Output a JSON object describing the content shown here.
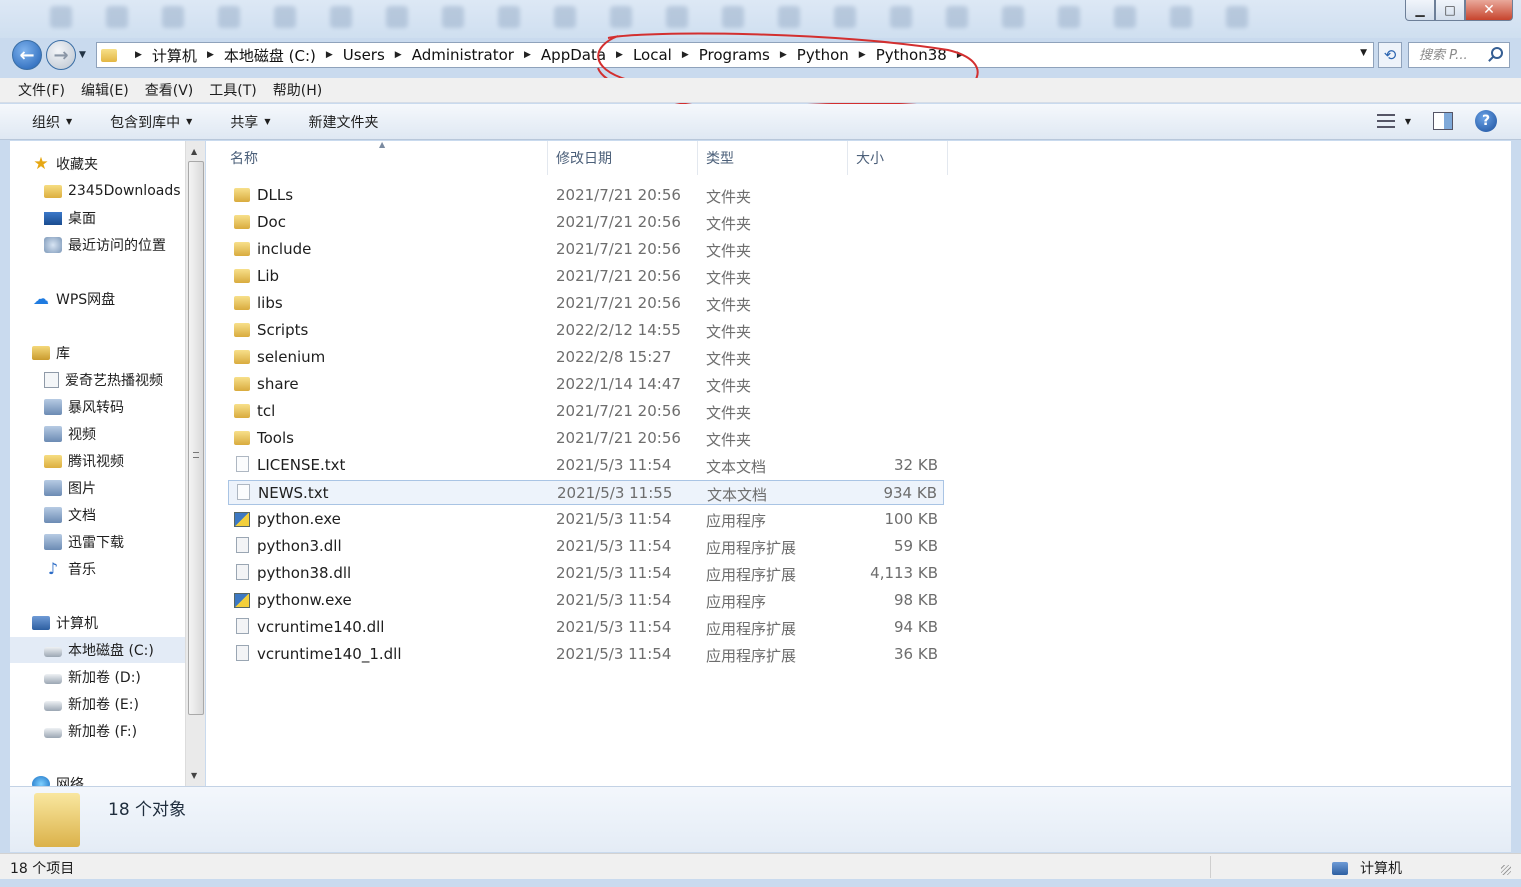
{
  "window": {
    "buttons": {
      "minimize": "▁",
      "maximize": "□",
      "close": "✕"
    }
  },
  "address": {
    "crumbs": [
      "计算机",
      "本地磁盘 (C:)",
      "Users",
      "Administrator",
      "AppData",
      "Local",
      "Programs",
      "Python",
      "Python38"
    ],
    "annotation_color": "#d32f2f"
  },
  "search": {
    "placeholder": "搜索 P..."
  },
  "menu": [
    "文件(F)",
    "编辑(E)",
    "查看(V)",
    "工具(T)",
    "帮助(H)"
  ],
  "toolbar": {
    "organize": "组织",
    "include_library": "包含到库中",
    "share": "共享",
    "new_folder": "新建文件夹"
  },
  "sidebar": {
    "favorites": {
      "label": "收藏夹",
      "items": [
        "2345Downloads",
        "桌面",
        "最近访问的位置"
      ]
    },
    "wps": "WPS网盘",
    "libraries": {
      "label": "库",
      "items": [
        "爱奇艺热播视频",
        "暴风转码",
        "视频",
        "腾讯视频",
        "图片",
        "文档",
        "迅雷下载",
        "音乐"
      ]
    },
    "computer": {
      "label": "计算机",
      "items": [
        "本地磁盘 (C:)",
        "新加卷 (D:)",
        "新加卷 (E:)",
        "新加卷 (F:)"
      ]
    },
    "network": "网络"
  },
  "columns": {
    "name": "名称",
    "date": "修改日期",
    "type": "类型",
    "size": "大小"
  },
  "files": [
    {
      "name": "DLLs",
      "date": "2021/7/21 20:56",
      "type": "文件夹",
      "size": "",
      "kind": "folder"
    },
    {
      "name": "Doc",
      "date": "2021/7/21 20:56",
      "type": "文件夹",
      "size": "",
      "kind": "folder"
    },
    {
      "name": "include",
      "date": "2021/7/21 20:56",
      "type": "文件夹",
      "size": "",
      "kind": "folder"
    },
    {
      "name": "Lib",
      "date": "2021/7/21 20:56",
      "type": "文件夹",
      "size": "",
      "kind": "folder"
    },
    {
      "name": "libs",
      "date": "2021/7/21 20:56",
      "type": "文件夹",
      "size": "",
      "kind": "folder"
    },
    {
      "name": "Scripts",
      "date": "2022/2/12 14:55",
      "type": "文件夹",
      "size": "",
      "kind": "folder"
    },
    {
      "name": "selenium",
      "date": "2022/2/8 15:27",
      "type": "文件夹",
      "size": "",
      "kind": "folder"
    },
    {
      "name": "share",
      "date": "2022/1/14 14:47",
      "type": "文件夹",
      "size": "",
      "kind": "folder"
    },
    {
      "name": "tcl",
      "date": "2021/7/21 20:56",
      "type": "文件夹",
      "size": "",
      "kind": "folder"
    },
    {
      "name": "Tools",
      "date": "2021/7/21 20:56",
      "type": "文件夹",
      "size": "",
      "kind": "folder"
    },
    {
      "name": "LICENSE.txt",
      "date": "2021/5/3 11:54",
      "type": "文本文档",
      "size": "32 KB",
      "kind": "txt"
    },
    {
      "name": "NEWS.txt",
      "date": "2021/5/3 11:55",
      "type": "文本文档",
      "size": "934 KB",
      "kind": "txt"
    },
    {
      "name": "python.exe",
      "date": "2021/5/3 11:54",
      "type": "应用程序",
      "size": "100 KB",
      "kind": "exe"
    },
    {
      "name": "python3.dll",
      "date": "2021/5/3 11:54",
      "type": "应用程序扩展",
      "size": "59 KB",
      "kind": "dll"
    },
    {
      "name": "python38.dll",
      "date": "2021/5/3 11:54",
      "type": "应用程序扩展",
      "size": "4,113 KB",
      "kind": "dll"
    },
    {
      "name": "pythonw.exe",
      "date": "2021/5/3 11:54",
      "type": "应用程序",
      "size": "98 KB",
      "kind": "exe"
    },
    {
      "name": "vcruntime140.dll",
      "date": "2021/5/3 11:54",
      "type": "应用程序扩展",
      "size": "94 KB",
      "kind": "dll"
    },
    {
      "name": "vcruntime140_1.dll",
      "date": "2021/5/3 11:54",
      "type": "应用程序扩展",
      "size": "36 KB",
      "kind": "dll"
    }
  ],
  "hovered_file": "NEWS.txt",
  "details": {
    "summary": "18 个对象"
  },
  "status": {
    "left": "18 个项目",
    "right": "计算机"
  }
}
